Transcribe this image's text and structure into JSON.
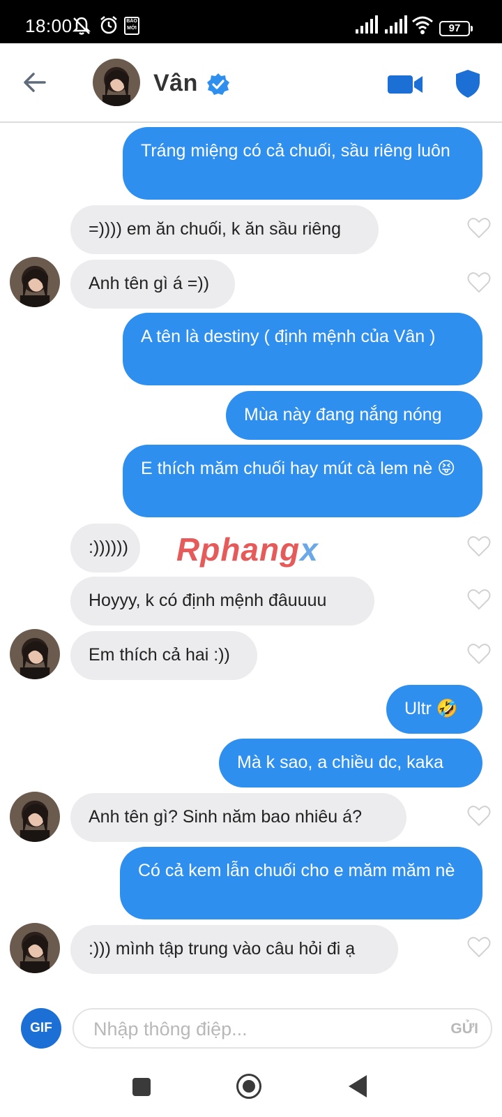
{
  "status_bar": {
    "time": "18:00",
    "app_badge": "BÁO MỚI",
    "battery": "97",
    "icons": [
      "mute-icon",
      "alarm-icon",
      "baomoi-icon",
      "signal-icon",
      "signal-icon",
      "wifi-icon",
      "battery-icon"
    ]
  },
  "header": {
    "name": "Vân",
    "verified": true,
    "icons": [
      "back-arrow-icon",
      "verified-badge-icon",
      "video-call-icon",
      "shield-icon"
    ]
  },
  "messages": [
    {
      "from": "me",
      "text": "Tráng miệng có cả chuối, sầu riêng luôn"
    },
    {
      "from": "them",
      "text": "=)))) em ăn chuối, k ăn sầu riêng"
    },
    {
      "from": "them",
      "text": "Anh tên gì á =))"
    },
    {
      "from": "me",
      "text": "A tên là destiny ( định mệnh của Vân )"
    },
    {
      "from": "me",
      "text": "Mùa này đang nắng nóng"
    },
    {
      "from": "me",
      "text": "E thích măm chuối hay mút cà lem nè 😝"
    },
    {
      "from": "them",
      "text": ":))))))"
    },
    {
      "from": "them",
      "text": "Hoyyy, k có định mệnh đâuuuu"
    },
    {
      "from": "them",
      "text": "Em thích cả hai :))"
    },
    {
      "from": "me",
      "text": "Ultr 🤣"
    },
    {
      "from": "me",
      "text": "Mà k sao, a chiều dc, kaka"
    },
    {
      "from": "them",
      "text": "Anh tên gì? Sinh năm bao nhiêu á?"
    },
    {
      "from": "me",
      "text": "Có cả kem lẫn chuối cho e măm măm nè"
    },
    {
      "from": "them",
      "text": ":))) mình tập trung vào câu hỏi đi ạ"
    }
  ],
  "watermark": {
    "part1": "Rphang",
    "part2": "x"
  },
  "composer": {
    "gif_label": "GIF",
    "placeholder": "Nhập thông điệp...",
    "send_label": "GỬI"
  },
  "colors": {
    "sent_bubble": "#2f8fef",
    "received_bubble": "#ececee",
    "accent": "#1c6fd4"
  }
}
